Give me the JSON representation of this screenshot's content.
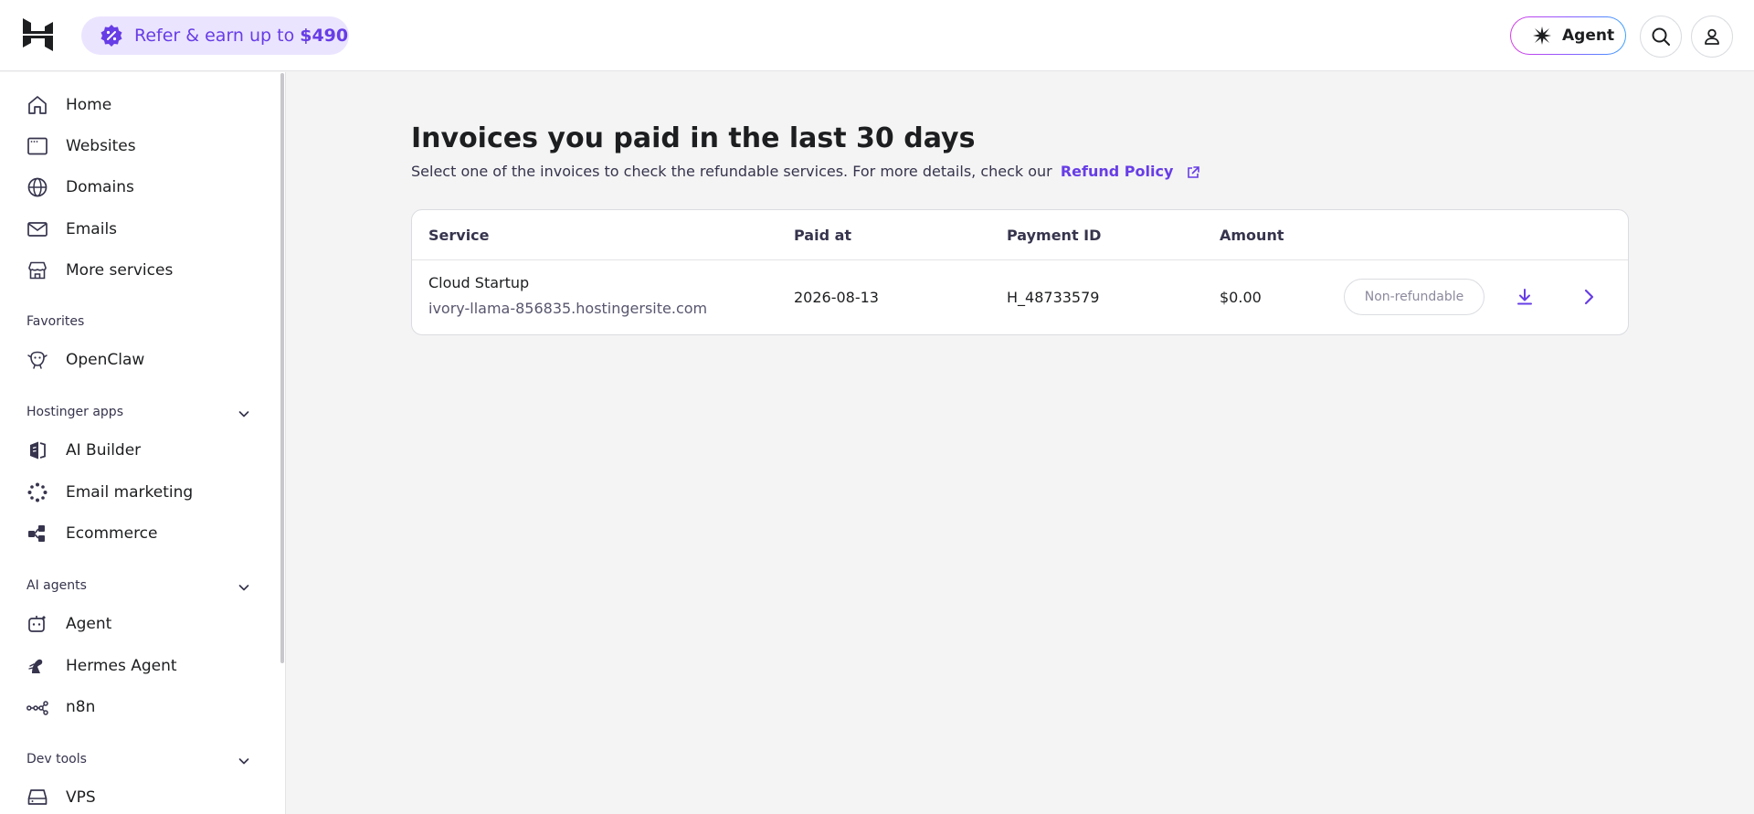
{
  "header": {
    "refer": {
      "text": "Refer & earn up to",
      "amount": "$490"
    },
    "agent_label": "Agent"
  },
  "sidebar": {
    "items": [
      {
        "label": "Home",
        "icon": "home-icon"
      },
      {
        "label": "Websites",
        "icon": "browser-icon"
      },
      {
        "label": "Domains",
        "icon": "globe-icon"
      },
      {
        "label": "Emails",
        "icon": "mail-icon"
      },
      {
        "label": "More services",
        "icon": "store-icon"
      }
    ],
    "favorites_label": "Favorites",
    "favorites": [
      {
        "label": "OpenClaw",
        "icon": "claw-icon"
      }
    ],
    "apps_label": "Hostinger apps",
    "apps": [
      {
        "label": "AI Builder",
        "icon": "builder-icon"
      },
      {
        "label": "Email marketing",
        "icon": "spark-icon"
      },
      {
        "label": "Ecommerce",
        "icon": "ecommerce-icon"
      }
    ],
    "agents_label": "AI agents",
    "agents": [
      {
        "label": "Agent",
        "icon": "robot-icon"
      },
      {
        "label": "Hermes Agent",
        "icon": "hermes-icon"
      },
      {
        "label": "n8n",
        "icon": "n8n-icon"
      }
    ],
    "devtools_label": "Dev tools",
    "devtools": [
      {
        "label": "VPS",
        "icon": "server-icon"
      }
    ]
  },
  "main": {
    "title": "Invoices you paid in the last 30 days",
    "subtitle": "Select one of the invoices to check the refundable services. For more details, check our",
    "refund_link": "Refund Policy",
    "table": {
      "headers": [
        "Service",
        "Paid at",
        "Payment ID",
        "Amount"
      ],
      "rows": [
        {
          "service": "Cloud Startup",
          "domain": "ivory-llama-856835.hostingersite.com",
          "paid_at": "2026-08-13",
          "payment_id": "H_48733579",
          "amount": "$0.00",
          "status": "Non-refundable"
        }
      ]
    }
  },
  "colors": {
    "accent": "#673de6",
    "accent_bg": "#ebe4ff",
    "page_bg": "#f4f4f4"
  }
}
